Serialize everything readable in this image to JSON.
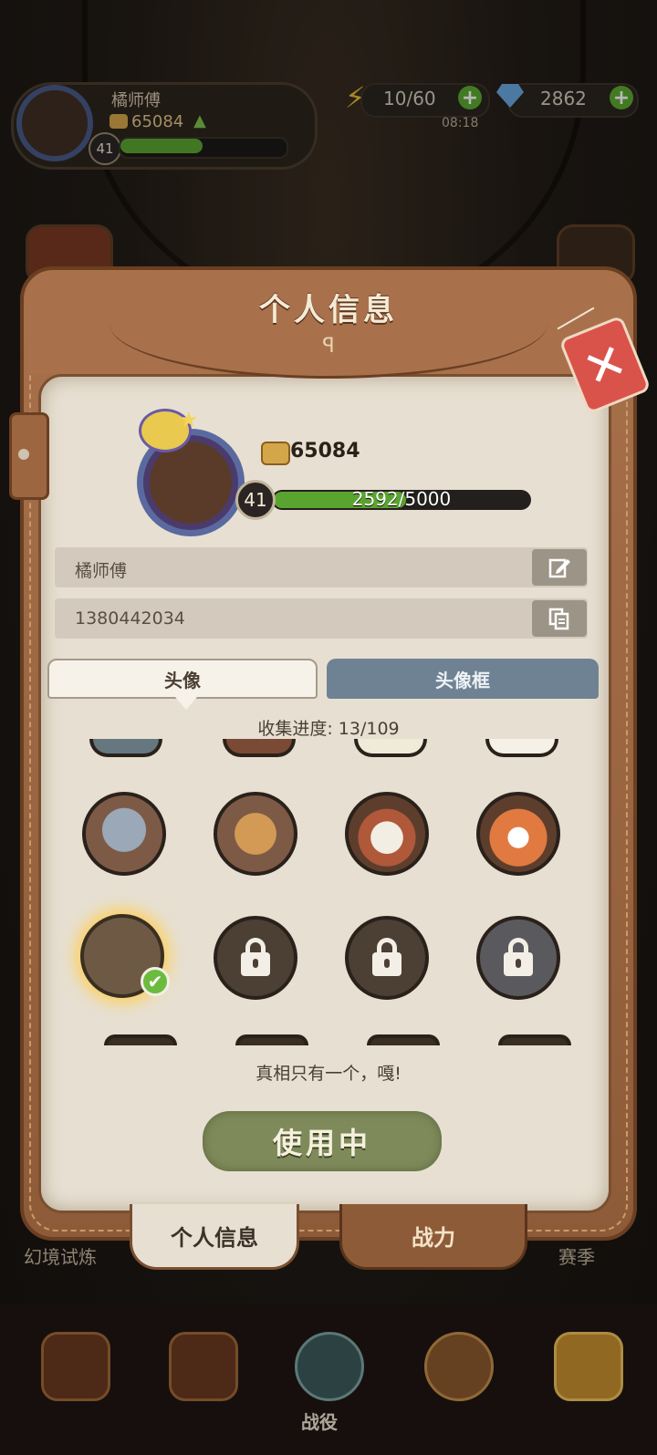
{
  "hud": {
    "player_name": "橘师傅",
    "coins": "65084",
    "level": "41",
    "energy": "10/60",
    "gems": "2862",
    "clock": "08:18",
    "plus_label": "+"
  },
  "background": {
    "left_tab_label": "幻境试炼",
    "right_tab_label": "赛季",
    "campaign_label": "战役"
  },
  "panel": {
    "title": "个人信息",
    "close_label": "✕",
    "profile": {
      "coins": "65084",
      "level": "41",
      "xp_text": "2592/5000",
      "xp_current": 2592,
      "xp_max": 5000
    },
    "name_value": "橘师傅",
    "id_value": "1380442034",
    "tabs": {
      "avatar": "头像",
      "frame": "头像框"
    },
    "collection_progress": "收集进度: 13/109",
    "avatar_caption": "真相只有一个，嘎!",
    "use_button": "使用中",
    "bottom_tabs": {
      "profile": "个人信息",
      "power": "战力"
    }
  },
  "icons": {
    "edit": "edit-icon",
    "copy": "copy-icon",
    "check": "✔",
    "energy": "⚡",
    "up_arrow": "▲",
    "star": "★",
    "ornament": "ꟼ"
  },
  "colors": {
    "accent_green": "#59a42e",
    "close_red": "#d9534b",
    "frame_tab_blue": "#6f8294",
    "panel_brown": "#a8714a"
  }
}
